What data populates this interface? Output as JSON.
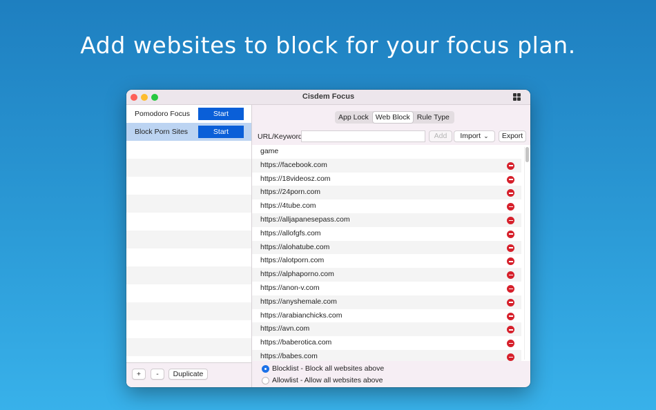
{
  "headline": "Add websites to block for your focus plan.",
  "window": {
    "title": "Cisdem Focus"
  },
  "plans": [
    {
      "name": "Pomodoro Focus",
      "button": "Start",
      "selected": false
    },
    {
      "name": "Block Porn Sites",
      "button": "Start",
      "selected": true
    }
  ],
  "sidebar_buttons": {
    "add": "+",
    "remove": "-",
    "duplicate": "Duplicate"
  },
  "tabs": [
    "App Lock",
    "Web Block",
    "Rule Type"
  ],
  "active_tab": "Web Block",
  "url_entry": {
    "label": "URL/Keyword",
    "value": "",
    "add": "Add",
    "import": "Import",
    "export": "Export"
  },
  "entries": [
    "game",
    "https://facebook.com",
    "https://18videosz.com",
    "https://24porn.com",
    "https://4tube.com",
    "https://alljapanesepass.com",
    "https://allofgfs.com",
    "https://alohatube.com",
    "https://alotporn.com",
    "https://alphaporno.com",
    "https://anon-v.com",
    "https://anyshemale.com",
    "https://arabianchicks.com",
    "https://avn.com",
    "https://baberotica.com",
    "https://babes.com"
  ],
  "modes": [
    {
      "label": "Blocklist - Block all websites above",
      "selected": true
    },
    {
      "label": "Allowlist - Allow all websites above",
      "selected": false
    }
  ]
}
